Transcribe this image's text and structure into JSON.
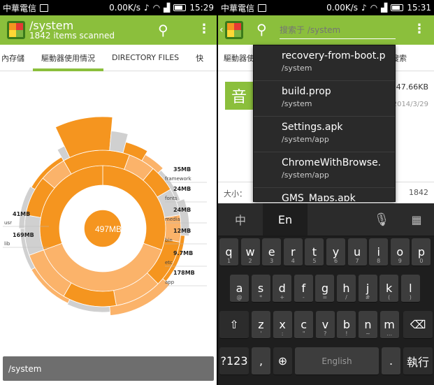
{
  "left": {
    "status": {
      "carrier": "中華電信",
      "speed": "0.00K/s",
      "time": "15:29"
    },
    "app": {
      "title": "/system",
      "subtitle": "1842 items scanned"
    },
    "tabs": [
      "內存儲",
      "驅動器使用情況",
      "DIRECTORY FILES",
      "快"
    ],
    "selected_tab": "驅動器使用情況",
    "center_label": "497MB",
    "right_labels": [
      {
        "size": "35MB",
        "name": "framework"
      },
      {
        "size": "24MB",
        "name": "fonts"
      },
      {
        "size": "24MB",
        "name": "media"
      },
      {
        "size": "12MB",
        "name": "bin"
      },
      {
        "size": "9.7MB",
        "name": "etc"
      },
      {
        "size": "178MB",
        "name": "app"
      }
    ],
    "left_labels": [
      {
        "size": "41MB",
        "name": "usr"
      },
      {
        "size": "169MB",
        "name": "lib"
      }
    ],
    "bottom_path": "/system"
  },
  "right": {
    "status": {
      "carrier": "中華電信",
      "speed": "0.00K/s",
      "time": "15:31"
    },
    "search": {
      "placeholder": "搜索于 /system"
    },
    "tabs": [
      "驅動器使",
      "快速搜索"
    ],
    "file": {
      "badge": "音",
      "size": "47.66KB",
      "date": "2014/3/29"
    },
    "size_row": {
      "label": "大小：",
      "value": "1842"
    },
    "suggestions": [
      {
        "name": "recovery-from-boot.p",
        "path": "/system"
      },
      {
        "name": "build.prop",
        "path": "/system"
      },
      {
        "name": "Settings.apk",
        "path": "/system/app"
      },
      {
        "name": "ChromeWithBrowse.",
        "path": "/system/app"
      },
      {
        "name": "GMS_Maps.apk",
        "path": ""
      }
    ],
    "keyboard": {
      "lang_zh": "中",
      "lang_en": "En",
      "row1": [
        {
          "k": "q",
          "s": "1"
        },
        {
          "k": "w",
          "s": "2"
        },
        {
          "k": "e",
          "s": "3"
        },
        {
          "k": "r",
          "s": "4"
        },
        {
          "k": "t",
          "s": "5"
        },
        {
          "k": "y",
          "s": "6"
        },
        {
          "k": "u",
          "s": "7"
        },
        {
          "k": "i",
          "s": "8"
        },
        {
          "k": "o",
          "s": "9"
        },
        {
          "k": "p",
          "s": "0"
        }
      ],
      "row2": [
        {
          "k": "a",
          "s": "@"
        },
        {
          "k": "s",
          "s": "*"
        },
        {
          "k": "d",
          "s": "+"
        },
        {
          "k": "f",
          "s": "-"
        },
        {
          "k": "g",
          "s": "="
        },
        {
          "k": "h",
          "s": "/"
        },
        {
          "k": "j",
          "s": "#"
        },
        {
          "k": "k",
          "s": "("
        },
        {
          "k": "l",
          "s": ")"
        }
      ],
      "row3": [
        {
          "k": "z",
          "s": "'"
        },
        {
          "k": "x",
          "s": ":"
        },
        {
          "k": "c",
          "s": "\""
        },
        {
          "k": "v",
          "s": "?"
        },
        {
          "k": "b",
          "s": "!"
        },
        {
          "k": "n",
          "s": "~"
        },
        {
          "k": "m",
          "s": "…"
        }
      ],
      "sym": "?123",
      "comma": ",",
      "space": "English",
      "period": ".",
      "enter": "執行"
    }
  },
  "colors": {
    "green": "#8bbf3c",
    "orange": "#f5951f",
    "light_orange": "#fbb36a",
    "grey": "#d0d0d0"
  }
}
